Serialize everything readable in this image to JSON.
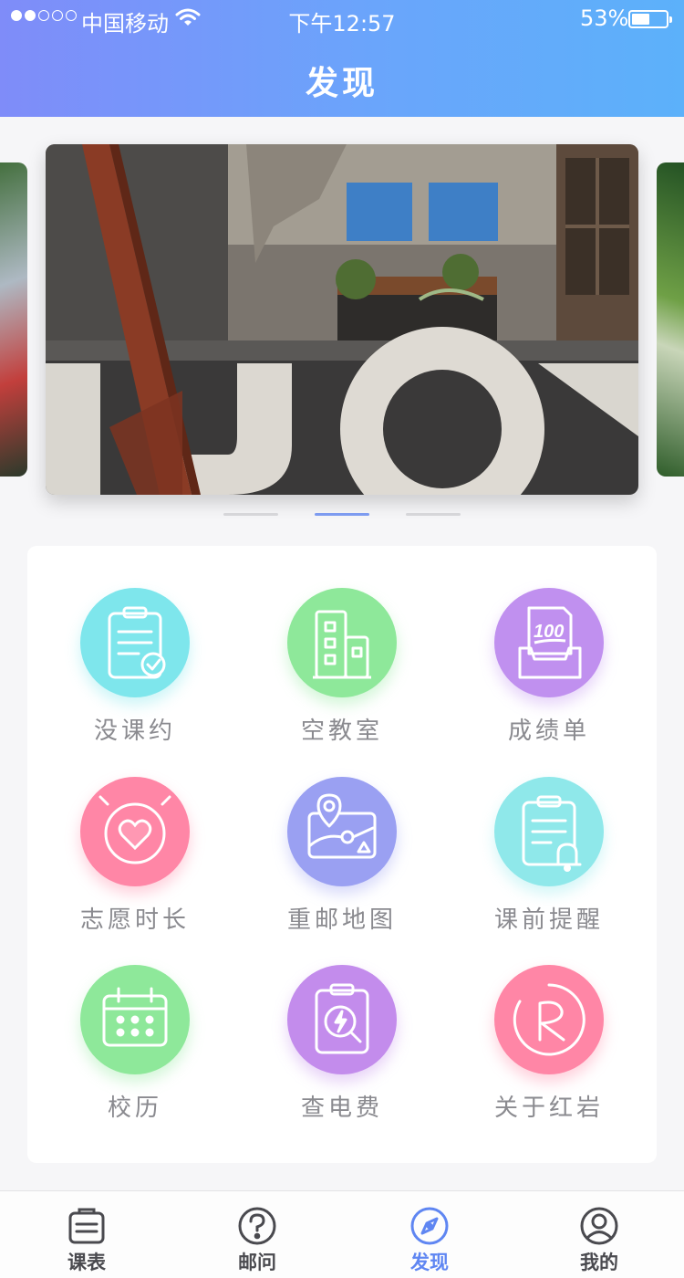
{
  "status_bar": {
    "carrier": "中国移动",
    "time": "下午12:57",
    "battery_percent": "53%",
    "battery_level": 0.53,
    "signal_bars_on": 2,
    "signal_bars_total": 5
  },
  "header": {
    "title": "发现"
  },
  "carousel": {
    "slide_count": 3,
    "active_index": 1
  },
  "features": [
    {
      "label": "没课约",
      "icon": "clipboard-check-icon",
      "color": "#7ee6ec"
    },
    {
      "label": "空教室",
      "icon": "building-icon",
      "color": "#8ee89a"
    },
    {
      "label": "成绩单",
      "icon": "score-100-icon",
      "color": "#c090ef"
    },
    {
      "label": "志愿时长",
      "icon": "heart-clock-icon",
      "color": "#ff86a6"
    },
    {
      "label": "重邮地图",
      "icon": "map-pin-icon",
      "color": "#9aa0f2"
    },
    {
      "label": "课前提醒",
      "icon": "clipboard-bell-icon",
      "color": "#8fe8ea"
    },
    {
      "label": "校历",
      "icon": "calendar-icon",
      "color": "#8ee89a"
    },
    {
      "label": "查电费",
      "icon": "electricity-search-icon",
      "color": "#c38cec"
    },
    {
      "label": "关于红岩",
      "icon": "redrock-r-icon",
      "color": "#ff86a6"
    }
  ],
  "tabbar": {
    "active": 2,
    "items": [
      {
        "label": "课表",
        "icon": "schedule-icon"
      },
      {
        "label": "邮问",
        "icon": "question-icon"
      },
      {
        "label": "发现",
        "icon": "compass-icon"
      },
      {
        "label": "我的",
        "icon": "profile-icon"
      }
    ]
  }
}
